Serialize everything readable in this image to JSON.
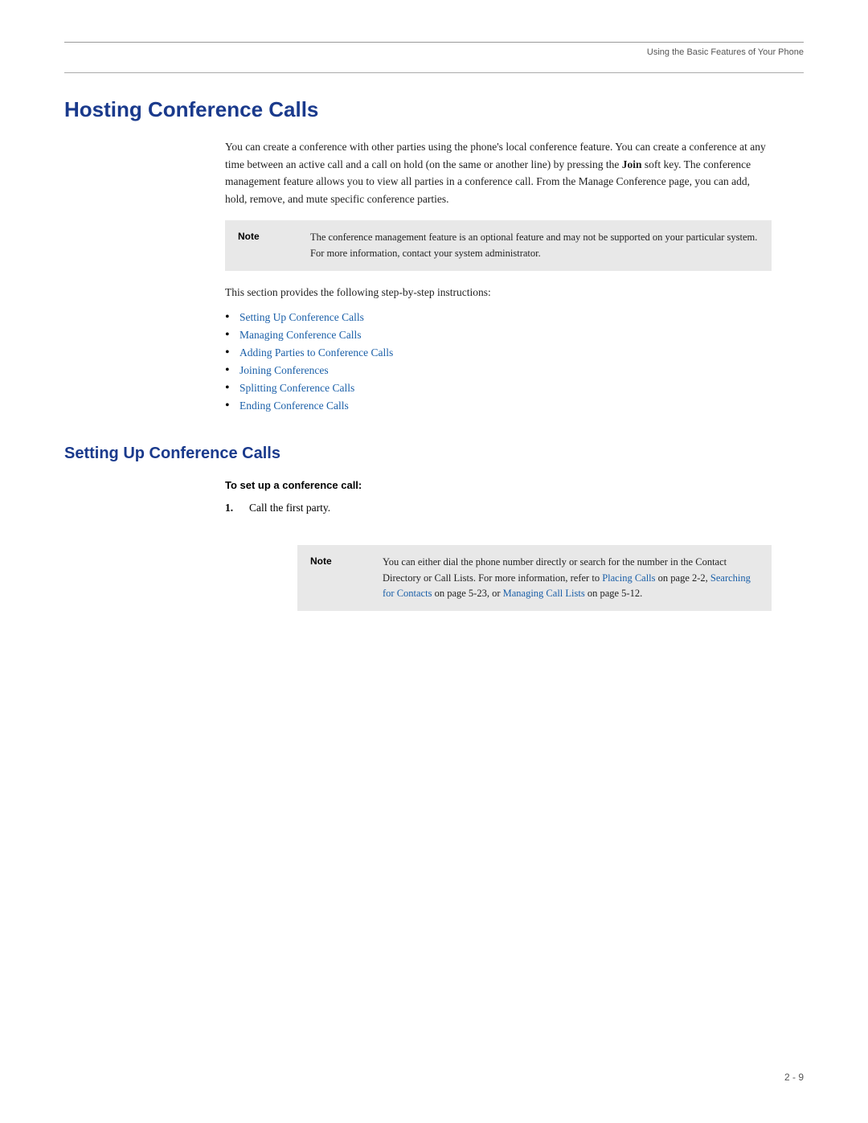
{
  "header": {
    "text": "Using the Basic Features of Your Phone"
  },
  "page": {
    "number": "2 - 9"
  },
  "hosting_section": {
    "title": "Hosting Conference Calls",
    "body": "You can create a conference with other parties using the phone's local conference feature. You can create a conference at any time between an active call and a call on hold (on the same or another line) by pressing the Join soft key. The conference management feature allows you to view all parties in a conference call. From the Manage Conference page, you can add, hold, remove, and mute specific conference parties.",
    "bold_word": "Join",
    "note_label": "Note",
    "note_text": "The conference management feature is an optional feature and may not be supported on your particular system. For more information, contact your system administrator.",
    "intro": "This section provides the following step-by-step instructions:",
    "links": [
      {
        "text": "Setting Up Conference Calls"
      },
      {
        "text": "Managing Conference Calls"
      },
      {
        "text": "Adding Parties to Conference Calls"
      },
      {
        "text": "Joining Conferences"
      },
      {
        "text": "Splitting Conference Calls"
      },
      {
        "text": "Ending Conference Calls"
      }
    ]
  },
  "setting_up_section": {
    "title": "Setting Up Conference Calls",
    "procedure_label": "To set up a conference call:",
    "steps": [
      {
        "num": "1.",
        "text": "Call the first party."
      }
    ],
    "note_label": "Note",
    "note_text": "You can either dial the phone number directly or search for the number in the Contact Directory or Call Lists. For more information, refer to ",
    "note_link1_text": "Placing Calls",
    "note_after1": " on page 2-2, ",
    "note_link2_text": "Searching for Contacts",
    "note_after2": " on page 5-23, or ",
    "note_link3_text": "Managing Call Lists",
    "note_after3": " on page 5-12."
  }
}
